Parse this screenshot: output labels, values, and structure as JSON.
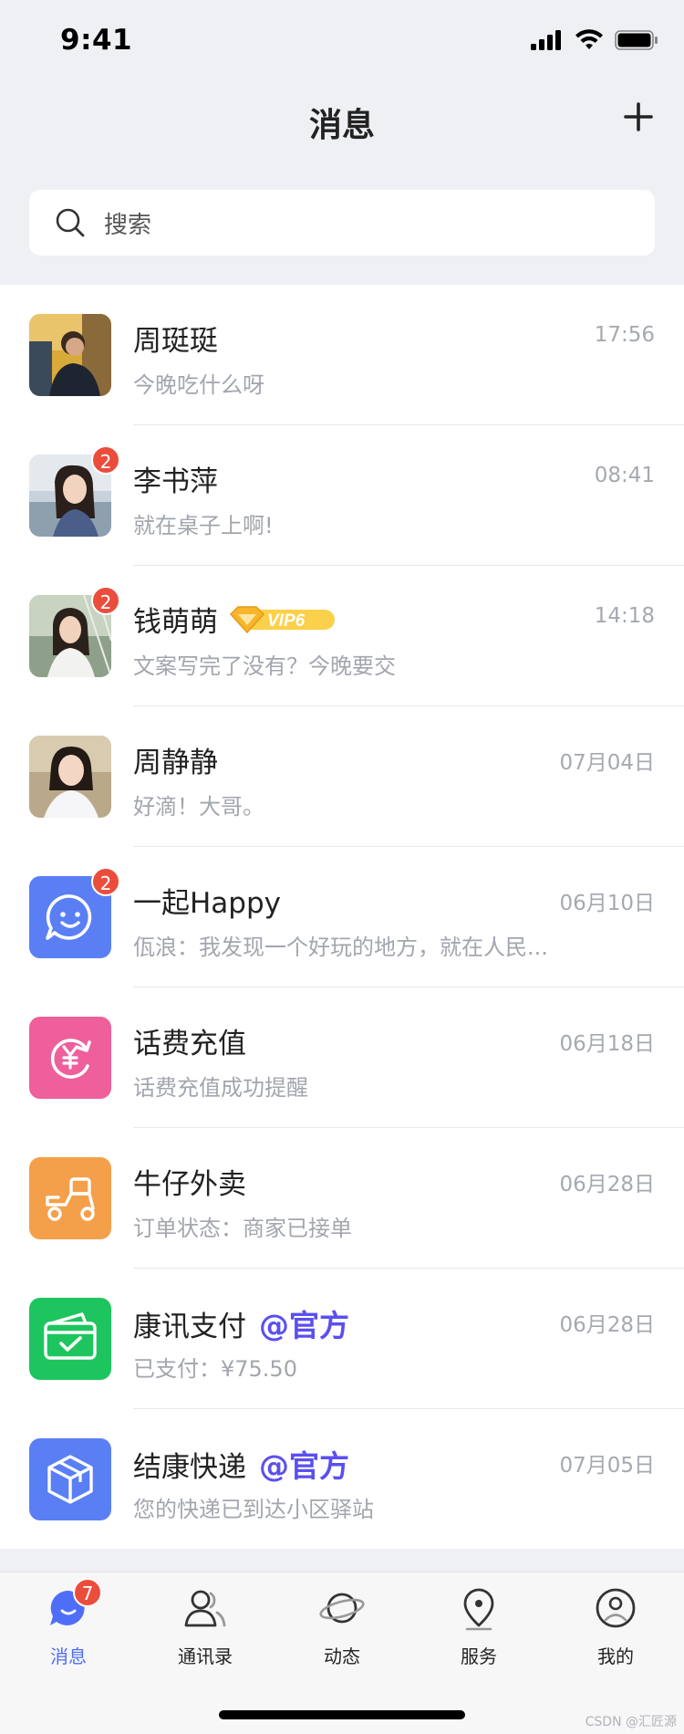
{
  "status": {
    "time": "9:41"
  },
  "nav": {
    "title": "消息"
  },
  "search": {
    "placeholder": "搜索"
  },
  "conversations": [
    {
      "name": "周珽珽",
      "time": "17:56",
      "preview": "今晚吃什么呀",
      "badge": "",
      "avatar": "photo-male-1"
    },
    {
      "name": "李书萍",
      "time": "08:41",
      "preview": "就在桌子上啊!",
      "badge": "2",
      "avatar": "photo-female-1"
    },
    {
      "name": "钱萌萌",
      "time": "14:18",
      "preview": "文案写完了没有？今晚要交",
      "badge": "2",
      "avatar": "photo-female-2",
      "vip": "VIP6"
    },
    {
      "name": "周静静",
      "time": "07月04日",
      "preview": "好滴！大哥。",
      "badge": "",
      "avatar": "photo-female-3"
    },
    {
      "name": "一起Happy",
      "time": "06月10日",
      "preview": "佤浪：我发现一个好玩的地方，就在人民...",
      "badge": "2",
      "avatar": "chat-bubble-icon"
    },
    {
      "name": "话费充值",
      "time": "06月18日",
      "preview": "话费充值成功提醒",
      "badge": "",
      "avatar": "yen-refresh-icon"
    },
    {
      "name": "牛仔外卖",
      "time": "06月28日",
      "preview": "订单状态：商家已接单",
      "badge": "",
      "avatar": "scooter-icon"
    },
    {
      "name": "康讯支付",
      "time": "06月28日",
      "preview": "已支付：¥75.50",
      "badge": "",
      "avatar": "wallet-check-icon",
      "official": "@官方"
    },
    {
      "name": "结康快递",
      "time": "07月05日",
      "preview": "您的快递已到达小区驿站",
      "badge": "",
      "avatar": "package-box-icon",
      "official": "@官方"
    }
  ],
  "tabs": [
    {
      "label": "消息",
      "icon": "message-icon",
      "badge": "7",
      "active": true
    },
    {
      "label": "通讯录",
      "icon": "contacts-icon"
    },
    {
      "label": "动态",
      "icon": "planet-icon"
    },
    {
      "label": "服务",
      "icon": "location-pin-icon"
    },
    {
      "label": "我的",
      "icon": "profile-icon"
    }
  ],
  "watermark": "CSDN @汇匠源",
  "colors": {
    "accent": "#4f6ef7",
    "badge": "#eb4d3d",
    "official": "#5b4ff0",
    "blue_icon": "#5a7ff5",
    "pink_icon": "#ee5f9b",
    "orange_icon": "#f4a04a",
    "green_icon": "#1ec55f"
  }
}
